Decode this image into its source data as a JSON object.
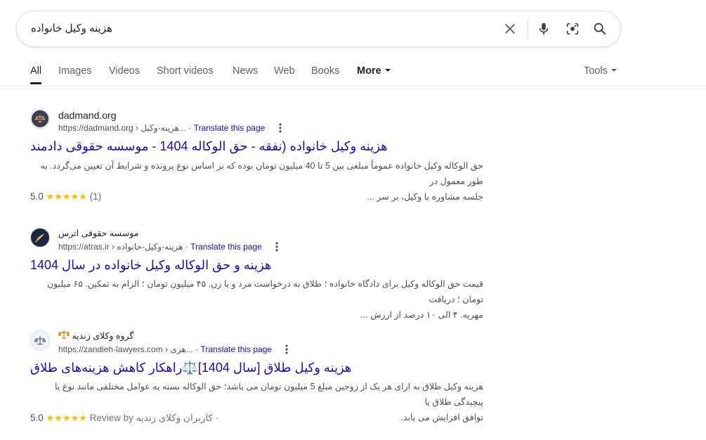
{
  "search": {
    "query": "هزینه وکیل خانواده"
  },
  "tabs": [
    {
      "label": "All"
    },
    {
      "label": "Images"
    },
    {
      "label": "Videos"
    },
    {
      "label": "Short videos"
    },
    {
      "label": "News"
    },
    {
      "label": "Web"
    },
    {
      "label": "Books"
    },
    {
      "label": "More"
    }
  ],
  "tools_label": "Tools",
  "results": [
    {
      "site_name": "dadmand.org",
      "url": "https://dadmand.org",
      "breadcrumb": "› هزینه-وکیل...",
      "translate": "Translate this page",
      "title": "هزینه وکیل خانواده (نفقه - حق الوکاله 1404 - موسسه حقوقی دادمند",
      "snippet_line1": "حق الوکاله وکیل خانواده عموماً مبلغی بین 5 تا 40 میلیون تومان بوده که بر اساس نوع پرونده و شرایط آن تعیین می‌گردد. به طور معمول در",
      "snippet_line2": "جلسه مشاوره با وکیل، بر سر ...",
      "rating_score": "5.0",
      "stars": "★★★★★",
      "rating_count": "(1)"
    },
    {
      "site_name": "موسسه حقوقی اترس",
      "url": "https://atras.ir",
      "breadcrumb": "› هزینه-وکیل-خانواده",
      "translate": "Translate this page",
      "title": "هزینه و حق الوکاله وکیل خانواده در سال 1404",
      "snippet_line1": "قیمت حق الوکاله وکیل برای دادگاه خانواده ؛ طلاق به درخواست مرد و یا زن. ۴۵ میلیون تومان ؛ الزام به تمکین. ۶۵ میلیون تومان ؛ دریافت",
      "snippet_line2": "مهریه. ۴ الی ۱۰ درصد از ارزش ..."
    },
    {
      "site_name": "گروه وکلای زندیه",
      "url": "https://zandieh-lawyers.com",
      "breadcrumb": "› هزی...",
      "translate": "Translate this page",
      "title": "هزینه وکیل طلاق [سال 1404]⚖️راهکار کاهش هزینه‌های طلاق",
      "snippet_line1": "هزینه وکیل طلاق به ازای هر یک از زوجین مبلغ 5 میلیون تومان می باشد؛ حق الوکاله بسته به عوامل مختلفی مانند نوع یا پیچیدگی طلاق یا",
      "snippet_line2": "توافق افزایش می یابد.",
      "rating_score": "5.0",
      "stars": "★★★★★",
      "rating_extra": "Review by کاربران وکلای زندیه ·"
    }
  ],
  "colors": {
    "link": "#1a0dab",
    "star": "#fbbc04",
    "muted": "#4d5156"
  }
}
